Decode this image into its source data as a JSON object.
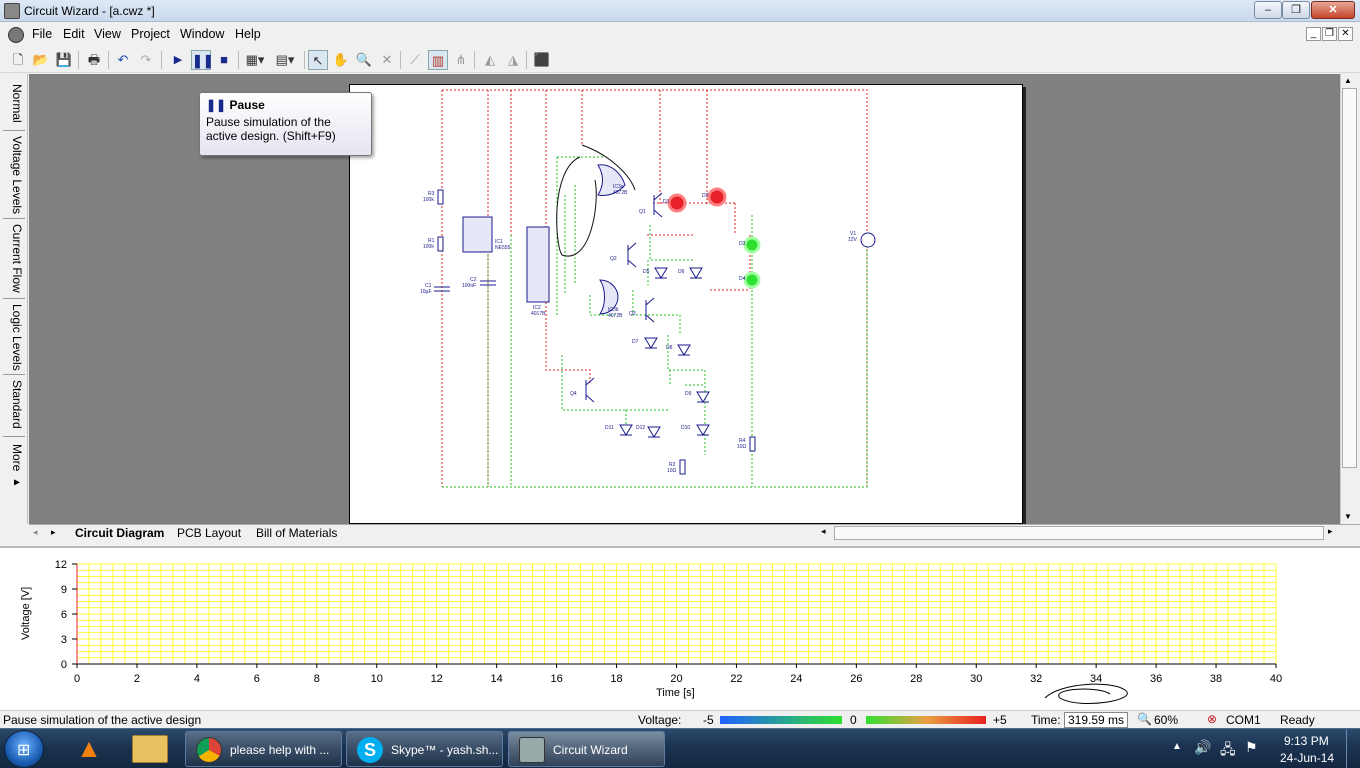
{
  "window": {
    "title": "Circuit Wizard - [a.cwz *]",
    "minimize": "‒",
    "maximize": "❐",
    "close": "✕"
  },
  "menu": [
    "File",
    "Edit",
    "View",
    "Project",
    "Window",
    "Help"
  ],
  "toolbar": {
    "icons": [
      "new-icon",
      "open-icon",
      "save-icon",
      "print-icon",
      "undo-icon",
      "redo-icon",
      "run-icon",
      "pause-icon",
      "stop-icon",
      "component-icon",
      "wire-icon",
      "select-icon",
      "pan-icon",
      "zoom-icon",
      "delete-icon",
      "probe-icon",
      "chart-icon",
      "network-icon",
      "flip-h-icon",
      "flip-v-icon",
      "chip-icon"
    ]
  },
  "tooltip": {
    "title": "Pause",
    "body": "Pause simulation of the active design. (Shift+F9)"
  },
  "left_tabs": [
    "Normal",
    "Voltage Levels",
    "Current Flow",
    "Logic Levels",
    "Standard",
    "More ▸"
  ],
  "bottom_tabs": [
    "Circuit Diagram",
    "PCB Layout",
    "Bill of Materials"
  ],
  "circuit": {
    "labels": [
      {
        "t": "R3"
      },
      {
        "t": "100k"
      },
      {
        "t": "R1"
      },
      {
        "t": "100k"
      },
      {
        "t": "C1"
      },
      {
        "t": "10µF"
      },
      {
        "t": "C2"
      },
      {
        "t": "100nF"
      },
      {
        "t": "IC1"
      },
      {
        "t": "NE555"
      },
      {
        "t": "IC2"
      },
      {
        "t": "4017B"
      },
      {
        "t": "IC3a"
      },
      {
        "t": "4072B"
      },
      {
        "t": "IC3b"
      },
      {
        "t": "4072B"
      },
      {
        "t": "Q1"
      },
      {
        "t": "Q2"
      },
      {
        "t": "Q3"
      },
      {
        "t": "Q4"
      },
      {
        "t": "D1"
      },
      {
        "t": "D2"
      },
      {
        "t": "D3"
      },
      {
        "t": "D4"
      },
      {
        "t": "D5"
      },
      {
        "t": "D6"
      },
      {
        "t": "D7"
      },
      {
        "t": "D8"
      },
      {
        "t": "D9"
      },
      {
        "t": "D10"
      },
      {
        "t": "D11"
      },
      {
        "t": "D12"
      },
      {
        "t": "R4"
      },
      {
        "t": "10Ω"
      },
      {
        "t": "R2"
      },
      {
        "t": "10Ω"
      },
      {
        "t": "V1"
      },
      {
        "t": "12V"
      }
    ]
  },
  "graph": {
    "ylabel": "Voltage [V]",
    "xlabel": "Time [s]",
    "yticks": [
      "0",
      "3",
      "6",
      "9",
      "12"
    ],
    "xticks": [
      "0",
      "2",
      "4",
      "6",
      "8",
      "10",
      "12",
      "14",
      "16",
      "18",
      "20",
      "22",
      "24",
      "26",
      "28",
      "30",
      "32",
      "34",
      "36",
      "38",
      "40"
    ],
    "ylim": [
      0,
      12
    ],
    "xlim": [
      0,
      40
    ],
    "grid_color": "#ffff00",
    "grid": true
  },
  "status": {
    "message": "Pause simulation of the active design",
    "voltage_label": "Voltage:",
    "v_min": "-5",
    "v_mid": "0",
    "v_max": "+5",
    "time_label": "Time:",
    "time_value": "319.59 ms",
    "zoom": "60%",
    "port": "COM1",
    "state": "Ready"
  },
  "taskbar": {
    "items": [
      "please help with ...",
      "Skype™ - yash.sh...",
      "Circuit Wizard"
    ],
    "clock_time": "9:13 PM",
    "clock_date": "24-Jun-14"
  },
  "colors": {
    "wire_red": "#e02020",
    "wire_green": "#20c020",
    "led_red": "#e8202a",
    "led_green": "#30e030",
    "component": "#1a1a8c"
  }
}
